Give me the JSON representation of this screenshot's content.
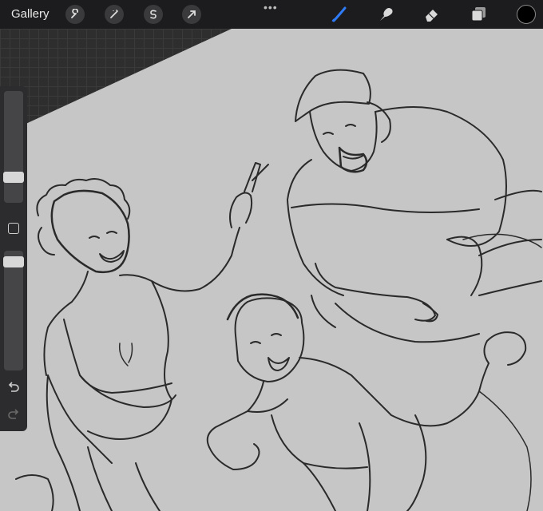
{
  "topbar": {
    "gallery_label": "Gallery",
    "tools_left": [
      "wrench-icon",
      "magic-wand-icon",
      "selection-s-icon",
      "transform-arrow-icon"
    ],
    "more_icon": "more-dots-icon",
    "tools_right": [
      "brush-icon",
      "smudge-icon",
      "eraser-icon",
      "layers-icon"
    ],
    "active_tool": "brush-icon",
    "active_color": "#000000",
    "accent_color": "#2f7bf5"
  },
  "sidebar": {
    "brush_size_level": 0.2,
    "opacity_level": 0.95,
    "modify_icon": "square-modify-icon",
    "undo_icon": "undo-icon",
    "redo_icon": "redo-icon"
  },
  "canvas": {
    "background_color": "#c8c8c8",
    "stroke_color": "#2a2a2a",
    "content": "sketch-drawing"
  }
}
